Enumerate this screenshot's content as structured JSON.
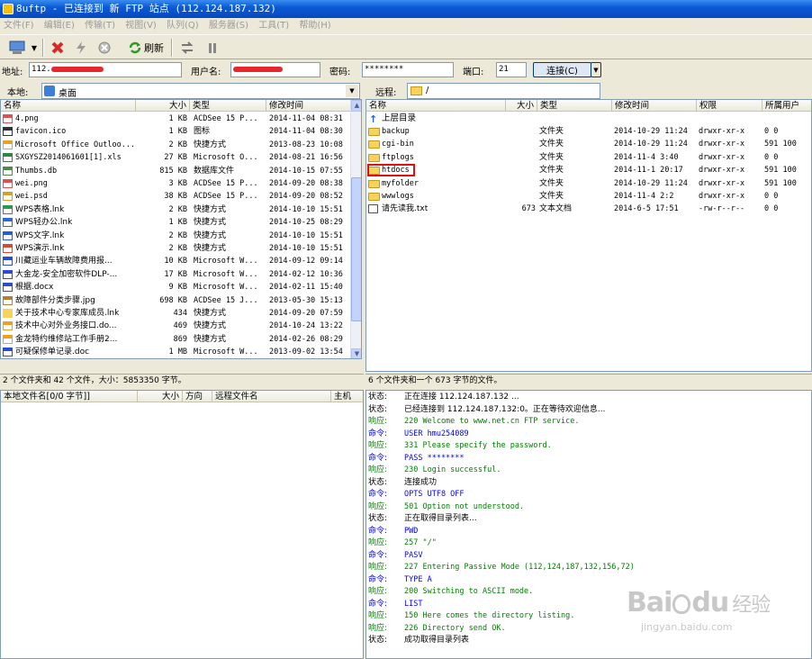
{
  "window": {
    "title": "8uftp - 已连接到 新 FTP 站点 (112.124.187.132)"
  },
  "menu": [
    "文件(F)",
    "编辑(E)",
    "传输(T)",
    "视图(V)",
    "队列(Q)",
    "服务器(S)",
    "工具(T)",
    "帮助(H)"
  ],
  "toolbar": {
    "refresh_label": "刷新"
  },
  "connection": {
    "address_label": "地址:",
    "address_value": "112.",
    "user_label": "用户名:",
    "password_label": "密码:",
    "password_value": "********",
    "port_label": "端口:",
    "port_value": "21",
    "connect_label": "连接(C)"
  },
  "local": {
    "path_label": "本地:",
    "path_value": "桌面",
    "columns": [
      "名称",
      "大小",
      "类型",
      "修改时间"
    ],
    "files": [
      {
        "name": "4.png",
        "size": "1 KB",
        "type": "ACDSee 15 P...",
        "date": "2014-11-04 08:31",
        "icon": "image-icon"
      },
      {
        "name": "favicon.ico",
        "size": "1 KB",
        "type": "图标",
        "date": "2014-11-04 08:30",
        "icon": "ico-icon"
      },
      {
        "name": "Microsoft Office Outloo...",
        "size": "2 KB",
        "type": "快捷方式",
        "date": "2013-08-23 10:08",
        "icon": "shortcut-icon"
      },
      {
        "name": "SXGYSZ2014061601[1].xls",
        "size": "27 KB",
        "type": "Microsoft O...",
        "date": "2014-08-21 16:56",
        "icon": "excel-icon"
      },
      {
        "name": "Thumbs.db",
        "size": "815 KB",
        "type": "数据库文件",
        "date": "2014-10-15 07:55",
        "icon": "db-icon"
      },
      {
        "name": "wei.png",
        "size": "3 KB",
        "type": "ACDSee 15 P...",
        "date": "2014-09-20 08:38",
        "icon": "image-icon"
      },
      {
        "name": "wei.psd",
        "size": "38 KB",
        "type": "ACDSee 15 P...",
        "date": "2014-09-20 08:52",
        "icon": "psd-icon"
      },
      {
        "name": "WPS表格.lnk",
        "size": "2 KB",
        "type": "快捷方式",
        "date": "2014-10-10 15:51",
        "icon": "wps-sheet-icon"
      },
      {
        "name": "WPS轻办公.lnk",
        "size": "1 KB",
        "type": "快捷方式",
        "date": "2014-10-25 08:29",
        "icon": "wps-cloud-icon"
      },
      {
        "name": "WPS文字.lnk",
        "size": "2 KB",
        "type": "快捷方式",
        "date": "2014-10-10 15:51",
        "icon": "wps-writer-icon"
      },
      {
        "name": "WPS演示.lnk",
        "size": "2 KB",
        "type": "快捷方式",
        "date": "2014-10-10 15:51",
        "icon": "wps-present-icon"
      },
      {
        "name": "川藏运业车辆故障费用报...",
        "size": "10 KB",
        "type": "Microsoft W...",
        "date": "2014-09-12 09:14",
        "icon": "word-icon"
      },
      {
        "name": "大金龙-安全加密软件DLP-...",
        "size": "17 KB",
        "type": "Microsoft W...",
        "date": "2014-02-12 10:36",
        "icon": "word-icon"
      },
      {
        "name": "根据.docx",
        "size": "9 KB",
        "type": "Microsoft W...",
        "date": "2014-02-11 15:40",
        "icon": "word-icon"
      },
      {
        "name": "故障部件分类步骤.jpg",
        "size": "698 KB",
        "type": "ACDSee 15 J...",
        "date": "2013-05-30 15:13",
        "icon": "jpg-icon"
      },
      {
        "name": "关于技术中心专家库成员.lnk",
        "size": "434",
        "type": "快捷方式",
        "date": "2014-09-20 07:59",
        "icon": "folder-shortcut-icon"
      },
      {
        "name": "技术中心对外业务接口.do...",
        "size": "469",
        "type": "快捷方式",
        "date": "2014-10-24 13:22",
        "icon": "shortcut-icon"
      },
      {
        "name": "金龙特约维修站工作手册2...",
        "size": "869",
        "type": "快捷方式",
        "date": "2014-02-26 08:29",
        "icon": "shortcut-icon"
      },
      {
        "name": "可疑保修单记录.doc",
        "size": "1 MB",
        "type": "Microsoft W...",
        "date": "2013-09-02 13:54",
        "icon": "word-icon"
      }
    ],
    "status": "2 个文件夹和 42 个文件，大小：5853350 字节。"
  },
  "remote": {
    "path_label": "远程:",
    "path_value": "/",
    "columns": [
      "名称",
      "大小",
      "类型",
      "修改时间",
      "权限",
      "所属用户"
    ],
    "parent_label": "上层目录",
    "files": [
      {
        "name": "backup",
        "size": "",
        "type": "文件夹",
        "date": "2014-10-29 11:24",
        "perm": "drwxr-xr-x",
        "owner": "0 0",
        "icon": "folder-icon"
      },
      {
        "name": "cgi-bin",
        "size": "",
        "type": "文件夹",
        "date": "2014-10-29 11:24",
        "perm": "drwxr-xr-x",
        "owner": "591 100",
        "icon": "folder-icon"
      },
      {
        "name": "ftplogs",
        "size": "",
        "type": "文件夹",
        "date": "2014-11-4 3:40",
        "perm": "drwxr-xr-x",
        "owner": "0 0",
        "icon": "folder-icon"
      },
      {
        "name": "htdocs",
        "size": "",
        "type": "文件夹",
        "date": "2014-11-1 20:17",
        "perm": "drwxr-xr-x",
        "owner": "591 100",
        "icon": "folder-icon",
        "highlight": true
      },
      {
        "name": "myfolder",
        "size": "",
        "type": "文件夹",
        "date": "2014-10-29 11:24",
        "perm": "drwxr-xr-x",
        "owner": "591 100",
        "icon": "folder-icon"
      },
      {
        "name": "wwwlogs",
        "size": "",
        "type": "文件夹",
        "date": "2014-11-4 2:2",
        "perm": "drwxr-xr-x",
        "owner": "0 0",
        "icon": "folder-icon"
      },
      {
        "name": "请先读我.txt",
        "size": "673",
        "type": "文本文档",
        "date": "2014-6-5 17:51",
        "perm": "-rw-r--r--",
        "owner": "0 0",
        "icon": "txt-icon"
      }
    ],
    "status": "6 个文件夹和一个 673 字节的文件。"
  },
  "queue": {
    "columns": [
      "本地文件名[0/0 字节]]",
      "大小",
      "方向",
      "远程文件名",
      "主机"
    ]
  },
  "log": [
    {
      "kind": "状态:",
      "text": "正在连接 112.124.187.132 ...",
      "color": "#000000"
    },
    {
      "kind": "状态:",
      "text": "已经连接到 112.124.187.132:0。正在等待欢迎信息...",
      "color": "#000000"
    },
    {
      "kind": "响应:",
      "text": "220 Welcome to www.net.cn FTP service.",
      "color": "#008000"
    },
    {
      "kind": "命令:",
      "text": "USER hmu254089",
      "color": "#0000ff"
    },
    {
      "kind": "响应:",
      "text": "331 Please specify the password.",
      "color": "#008000"
    },
    {
      "kind": "命令:",
      "text": "PASS ********",
      "color": "#0000ff"
    },
    {
      "kind": "响应:",
      "text": "230 Login successful.",
      "color": "#008000"
    },
    {
      "kind": "状态:",
      "text": "连接成功",
      "color": "#000000"
    },
    {
      "kind": "命令:",
      "text": "OPTS UTF8 OFF",
      "color": "#0000ff"
    },
    {
      "kind": "响应:",
      "text": "501 Option not understood.",
      "color": "#008000"
    },
    {
      "kind": "状态:",
      "text": "正在取得目录列表...",
      "color": "#000000"
    },
    {
      "kind": "命令:",
      "text": "PWD",
      "color": "#0000ff"
    },
    {
      "kind": "响应:",
      "text": "257 \"/\"",
      "color": "#008000"
    },
    {
      "kind": "命令:",
      "text": "PASV",
      "color": "#0000ff"
    },
    {
      "kind": "响应:",
      "text": "227 Entering Passive Mode (112,124,187,132,156,72)",
      "color": "#008000"
    },
    {
      "kind": "命令:",
      "text": "TYPE A",
      "color": "#0000ff"
    },
    {
      "kind": "响应:",
      "text": "200 Switching to ASCII mode.",
      "color": "#008000"
    },
    {
      "kind": "命令:",
      "text": "LIST",
      "color": "#0000ff"
    },
    {
      "kind": "响应:",
      "text": "150 Here comes the directory listing.",
      "color": "#008000"
    },
    {
      "kind": "响应:",
      "text": "226 Directory send OK.",
      "color": "#008000"
    },
    {
      "kind": "状态:",
      "text": "成功取得目录列表",
      "color": "#000000"
    }
  ],
  "watermark": {
    "brand": "Bai",
    "brand2": "du",
    "tag": "经验",
    "url": "jingyan.baidu.com"
  }
}
